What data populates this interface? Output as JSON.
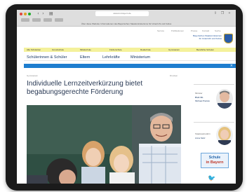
{
  "browser": {
    "url": "www.km.bayern.de",
    "notice": "Über diese Website: Informationen des Bayerischen Staatsministeriums für Unterricht und Kultus"
  },
  "site": {
    "utility_links": [
      "Service",
      "Publikationen",
      "Presse",
      "Kontakt",
      "Suche"
    ],
    "ministry_name_lines": [
      "Bayerisches Staatsministerium",
      "für Unterricht und Kultus"
    ],
    "yellow_nav": [
      "Alle Schularten",
      "Grundschule",
      "Mittelschule",
      "Förderschule",
      "Realschule",
      "Gymnasium",
      "Berufliche Schulen"
    ],
    "main_nav": [
      "Schülerinnen & Schüler",
      "Eltern",
      "Lehrkräfte",
      "Ministerium"
    ]
  },
  "article": {
    "category": "Gymnasium",
    "print_label": "Drucken",
    "headline_line1": "Individuelle Lernzeitverkürzung bietet",
    "headline_line2": "begabungsgerechte Förderung"
  },
  "sidebar": {
    "contact1": [
      "Minister",
      "Prof. Dr.",
      "Michael Piazolo"
    ],
    "contact2": [
      "Staatssekretärin",
      "Anna Stolz"
    ],
    "badge_line1": "Schule",
    "badge_line2": "in Bayern"
  },
  "colors": {
    "accent_blue": "#1e7ecf",
    "nav_yellow": "#f4f19b",
    "headline_text": "#2a3a55"
  },
  "icons": {
    "twitter": "twitter-bird-icon",
    "back": "back-arrow-icon",
    "forward": "forward-arrow-icon",
    "close": "close-icon"
  }
}
